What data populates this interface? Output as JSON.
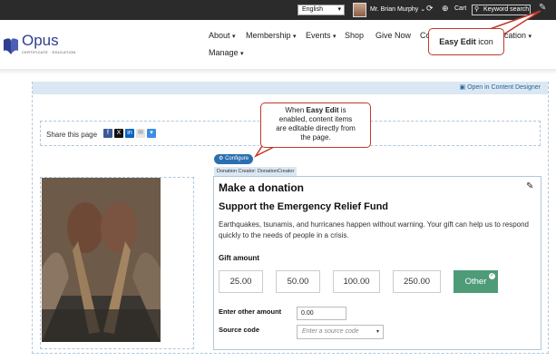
{
  "topbar": {
    "language": "English",
    "user_name": "Mr. Brian Murphy",
    "cart_label": "Cart",
    "search_label": "Keyword search"
  },
  "header": {
    "logo_text": "Opus",
    "logo_tagline": "CERTIFICATE · EDUCATION",
    "nav": [
      {
        "label": "About",
        "has_menu": true
      },
      {
        "label": "Membership",
        "has_menu": true
      },
      {
        "label": "Events",
        "has_menu": true
      },
      {
        "label": "Shop",
        "has_menu": false
      },
      {
        "label": "Give Now",
        "has_menu": false
      },
      {
        "label": "Co",
        "has_menu": false
      },
      {
        "label": "cation",
        "has_menu": true
      },
      {
        "label": "Manage",
        "has_menu": true
      }
    ]
  },
  "callouts": {
    "easy_edit_bold": "Easy Edit",
    "easy_edit_rest": " icon",
    "main_line1_pre": "When ",
    "main_line1_bold": "Easy Edit",
    "main_line1_post": " is",
    "main_line2": "enabled, content items",
    "main_line3": "are editable directly from",
    "main_line4": "the page."
  },
  "content_designer_link": "Open in Content Designer",
  "share": {
    "label": "Share this page",
    "icons": [
      "facebook-icon",
      "x-icon",
      "linkedin-icon",
      "email-icon",
      "more-icon"
    ]
  },
  "configure_label": "Configure",
  "creator_tag": "Donation Creator: DonationCreator",
  "donation": {
    "title": "Make a donation",
    "subtitle": "Support the Emergency Relief Fund",
    "description": "Earthquakes, tsunamis, and hurricanes happen without warning. Your gift can help us to respond quickly to the needs of people in a crisis.",
    "gift_label": "Gift amount",
    "amounts": [
      "25.00",
      "50.00",
      "100.00",
      "250.00",
      "Other"
    ],
    "selected": "Other",
    "other_label": "Enter other amount",
    "other_value": "0.00",
    "source_label": "Source code",
    "source_placeholder": "Enter a source code"
  },
  "colors": {
    "topbar": "#2b2b2b",
    "brand": "#2e3f8f",
    "accent_green": "#4e9b78",
    "callout_border": "#c0392b",
    "link_blue": "#2a6496"
  }
}
